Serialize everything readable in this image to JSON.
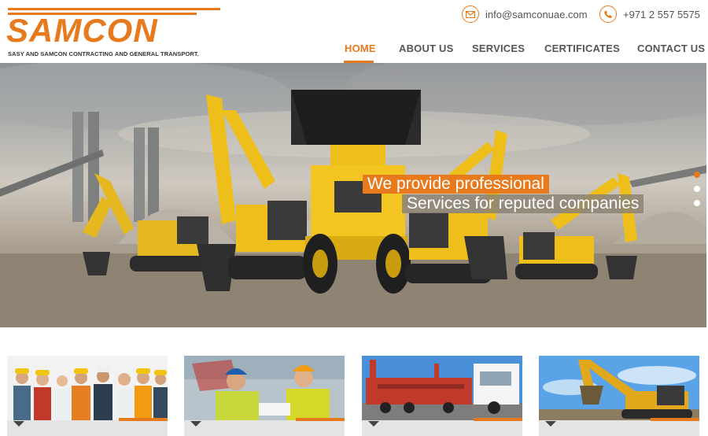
{
  "brand": {
    "name": "SAMCON",
    "tagline": "SASY AND SAMCON CONTRACTING AND GENERAL TRANSPORT.",
    "accent_color": "#e87a1e"
  },
  "contact": {
    "email": "info@samconuae.com",
    "email_icon": "envelope-icon",
    "phone": "+971 2 557 5575",
    "phone_icon": "phone-icon"
  },
  "nav": {
    "items": [
      {
        "label": "HOME",
        "active": true
      },
      {
        "label": "ABOUT US",
        "active": false
      },
      {
        "label": "SERVICES",
        "active": false
      },
      {
        "label": "CERTIFICATES",
        "active": false
      },
      {
        "label": "CONTACT US",
        "active": false
      }
    ]
  },
  "hero": {
    "caption_line1": "We provide professional",
    "caption_line2": "Services for reputed companies",
    "slide_count": 3,
    "active_slide": 1
  },
  "cards": [
    {
      "image": "workers-team-photo"
    },
    {
      "image": "site-engineers-photo"
    },
    {
      "image": "heavy-trucks-photo"
    },
    {
      "image": "excavator-photo"
    }
  ]
}
